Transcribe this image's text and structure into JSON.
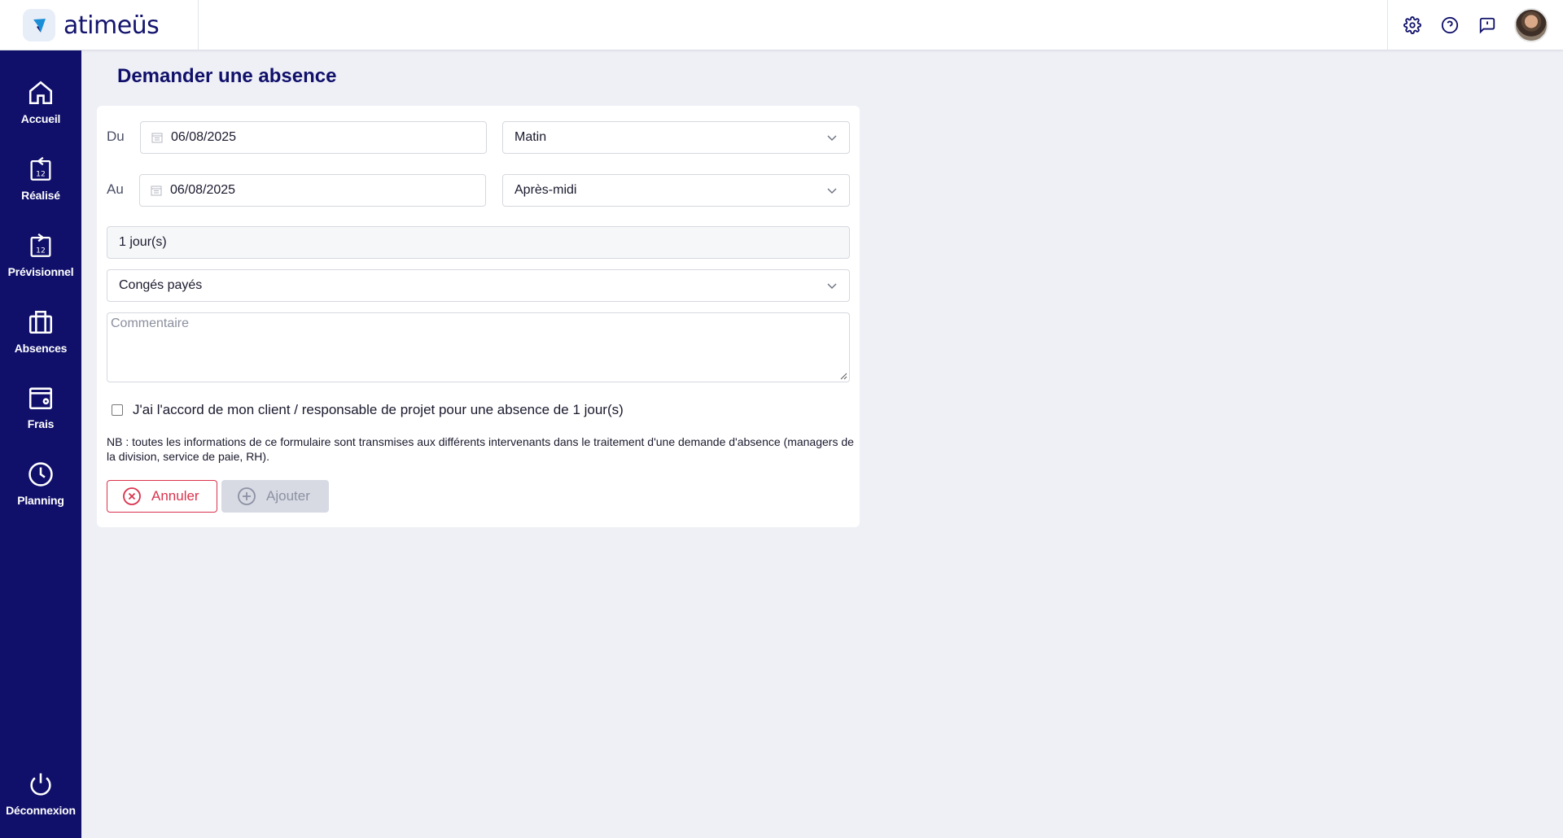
{
  "app": {
    "logo_text": "atimeüs",
    "brand_color": "#10106b"
  },
  "header": {
    "icons": [
      "gear-icon",
      "help-icon",
      "feedback-icon"
    ],
    "avatar": "user-avatar"
  },
  "sidebar": {
    "items": [
      {
        "label": "Accueil",
        "icon": "home-icon"
      },
      {
        "label": "Réalisé",
        "icon": "calendar-back-icon"
      },
      {
        "label": "Prévisionnel",
        "icon": "calendar-forward-icon"
      },
      {
        "label": "Absences",
        "icon": "suitcase-icon"
      },
      {
        "label": "Frais",
        "icon": "wallet-icon"
      },
      {
        "label": "Planning",
        "icon": "clock-icon"
      }
    ],
    "logout": {
      "label": "Déconnexion",
      "icon": "power-icon"
    }
  },
  "page": {
    "title": "Demander une absence"
  },
  "form": {
    "from_label": "Du",
    "from_date": "06/08/2025",
    "from_period": "Matin",
    "to_label": "Au",
    "to_date": "06/08/2025",
    "to_period": "Après-midi",
    "duration": "1 jour(s)",
    "absence_type": "Congés payés",
    "comment_placeholder": "Commentaire",
    "agreement_label": "J'ai l'accord de mon client / responsable de projet pour une absence de 1 jour(s)",
    "agreement_checked": false,
    "nb_text": "NB : toutes les informations de ce formulaire sont transmises aux différents intervenants dans le traitement d'une demande d'absence (managers de la division, service de paie, RH).",
    "cancel_label": "Annuler",
    "add_label": "Ajouter"
  }
}
